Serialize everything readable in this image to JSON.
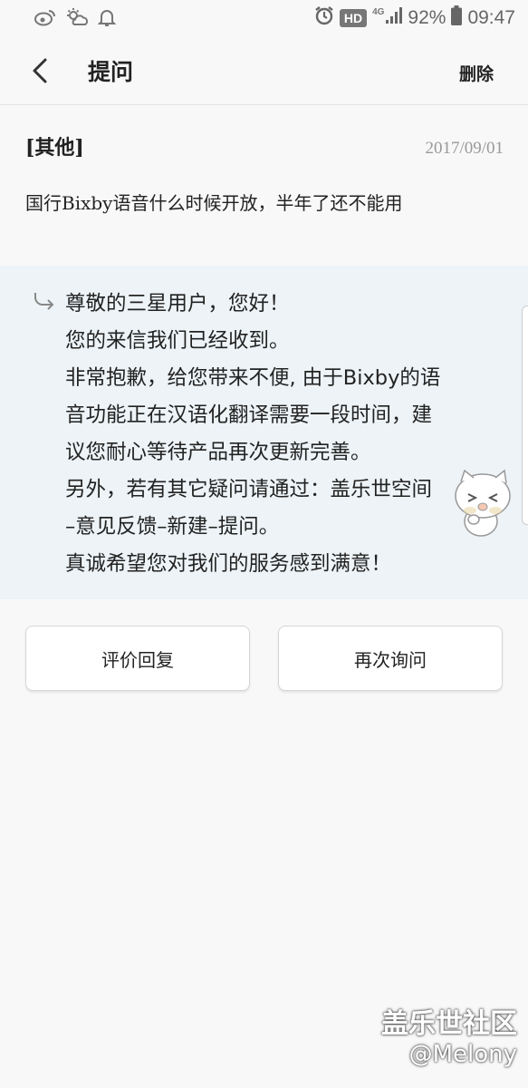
{
  "status_bar": {
    "left_icons": [
      "weibo-icon",
      "weather-icon",
      "bell-icon"
    ],
    "right_icons": [
      "alarm-icon",
      "signal-icon",
      "battery-icon"
    ],
    "hd_badge": "HD",
    "network": "4G",
    "battery_percent": "92%",
    "time": "09:47"
  },
  "header": {
    "title": "提问",
    "delete_label": "删除"
  },
  "question": {
    "category": "[其他]",
    "date": "2017/09/01",
    "text": "国行Bixby语音什么时候开放，半年了还不能用"
  },
  "reply": {
    "lines": [
      "尊敬的三星用户，您好！",
      "您的来信我们已经收到。",
      "非常抱歉，给您带来不便, 由于Bixby的语",
      "音功能正在汉语化翻译需要一段时间，建",
      "议您耐心等待产品再次更新完善。",
      "另外，若有其它疑问请通过：盖乐世空间",
      "–意见反馈–新建–提问。",
      "真诚希望您对我们的服务感到满意！"
    ]
  },
  "buttons": {
    "rate_label": "评价回复",
    "ask_again_label": "再次询问"
  },
  "watermark": {
    "line1": "盖乐世社区",
    "line2": "@Melony"
  }
}
